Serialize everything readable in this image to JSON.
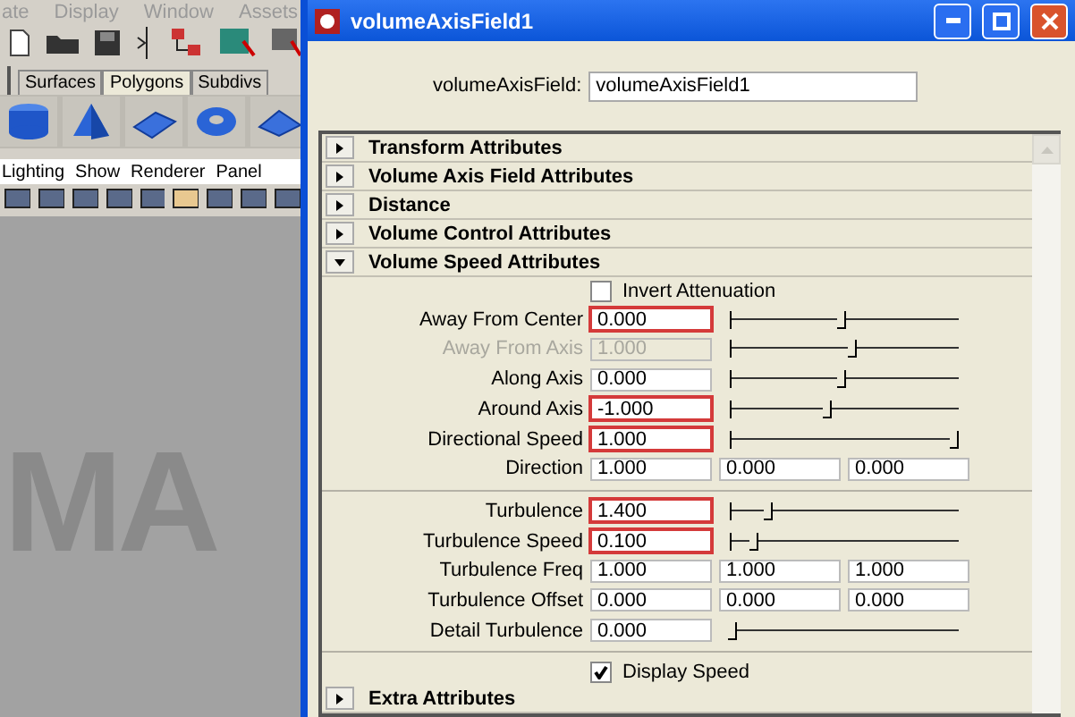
{
  "app": {
    "menu": [
      "ate",
      "Display",
      "Window",
      "Assets"
    ],
    "shelf_tabs": [
      {
        "label": "Surfaces",
        "selected": false
      },
      {
        "label": "Polygons",
        "selected": true
      },
      {
        "label": "Subdivs",
        "selected": false
      }
    ],
    "panel_menu": [
      "Lighting",
      "Show",
      "Renderer",
      "Panel"
    ],
    "viewport_text": "MA"
  },
  "window": {
    "title": "volumeAxisField1"
  },
  "node_field": {
    "label": "volumeAxisField:",
    "value": "volumeAxisField1"
  },
  "sections": [
    {
      "title": "Transform Attributes",
      "expanded": false
    },
    {
      "title": "Volume Axis Field Attributes",
      "expanded": false
    },
    {
      "title": "Distance",
      "expanded": false
    },
    {
      "title": "Volume Control Attributes",
      "expanded": false
    },
    {
      "title": "Volume Speed Attributes",
      "expanded": true,
      "rows": [
        {
          "kind": "checkbox",
          "label": "Invert Attenuation",
          "checked": false
        },
        {
          "kind": "slider",
          "label": "Away From Center",
          "value": "0.000",
          "keyed": true,
          "disabled": false,
          "level": 0.5
        },
        {
          "kind": "slider",
          "label": "Away From Axis",
          "value": "1.000",
          "keyed": false,
          "disabled": true,
          "level": 0.55
        },
        {
          "kind": "slider",
          "label": "Along Axis",
          "value": "0.000",
          "keyed": false,
          "disabled": false,
          "level": 0.5
        },
        {
          "kind": "slider",
          "label": "Around Axis",
          "value": "-1.000",
          "keyed": true,
          "disabled": false,
          "level": 0.44
        },
        {
          "kind": "slider",
          "label": "Directional Speed",
          "value": "1.000",
          "keyed": true,
          "disabled": false,
          "level": 1
        },
        {
          "kind": "triple",
          "label": "Direction",
          "values": [
            "1.000",
            "0.000",
            "0.000"
          ]
        },
        {
          "kind": "divider"
        },
        {
          "kind": "slider",
          "label": "Turbulence",
          "value": "1.400",
          "keyed": true,
          "disabled": false,
          "level": 0.18
        },
        {
          "kind": "slider",
          "label": "Turbulence Speed",
          "value": "0.100",
          "keyed": true,
          "disabled": false,
          "level": 0.12
        },
        {
          "kind": "triple",
          "label": "Turbulence Freq",
          "values": [
            "1.000",
            "1.000",
            "1.000"
          ]
        },
        {
          "kind": "triple",
          "label": "Turbulence Offset",
          "values": [
            "0.000",
            "0.000",
            "0.000"
          ]
        },
        {
          "kind": "slider",
          "label": "Detail Turbulence",
          "value": "0.000",
          "keyed": false,
          "disabled": false,
          "level": 0.02
        },
        {
          "kind": "divider"
        },
        {
          "kind": "checkbox",
          "label": "Display Speed",
          "checked": true
        }
      ]
    },
    {
      "title": "Extra Attributes",
      "expanded": false
    }
  ]
}
